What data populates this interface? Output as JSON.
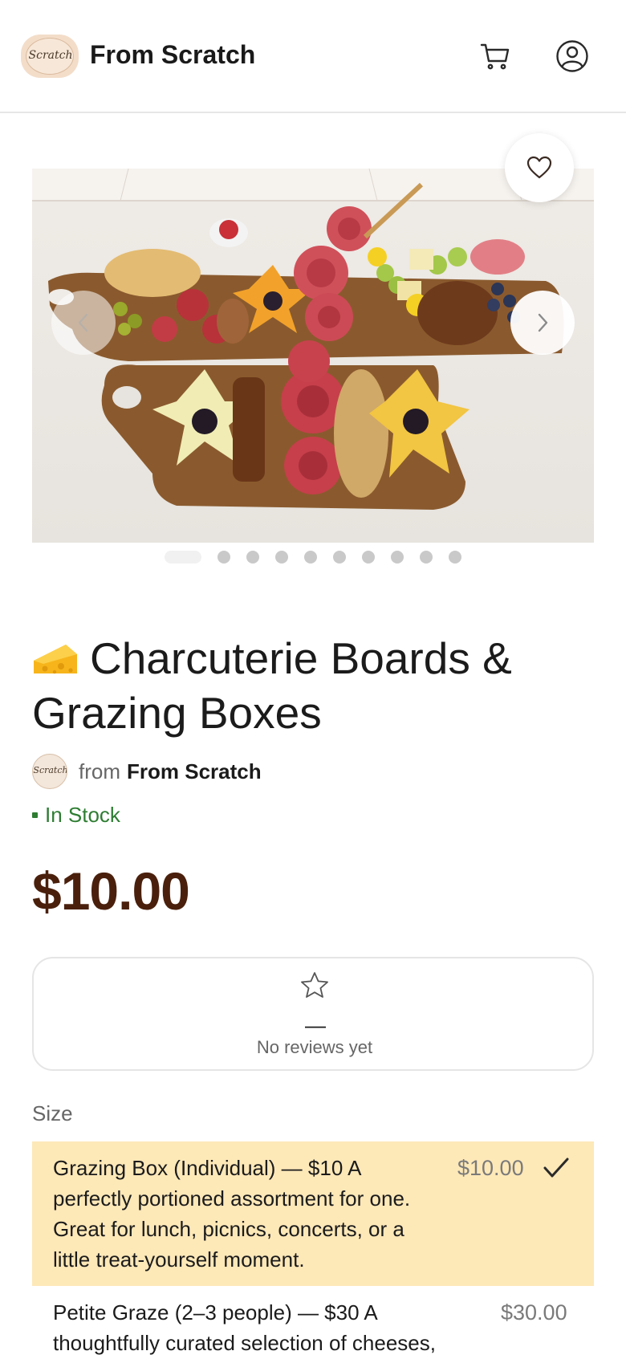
{
  "header": {
    "logo_text": "Scratch",
    "brand": "From Scratch",
    "cart_icon": "cart-icon",
    "account_icon": "user-circle-icon"
  },
  "gallery": {
    "image_alt": "Charcuterie boards with salami roses, cheese flowers, crackers, olives and berries",
    "image_count": 10,
    "active_index": 0,
    "favorite_icon": "heart-icon",
    "prev_icon": "chevron-left-icon",
    "next_icon": "chevron-right-icon"
  },
  "product": {
    "emoji_icon": "cheese-icon",
    "title": "Charcuterie Boards & Grazing Boxes",
    "seller_from": "from",
    "seller_name": "From Scratch",
    "stock": "In Stock",
    "price": "$10.00"
  },
  "reviews": {
    "star_icon": "star-outline-icon",
    "rating_placeholder": "—",
    "empty_text": "No reviews yet"
  },
  "size": {
    "label": "Size",
    "options": [
      {
        "text": "Grazing Box (Individual) — $10 A perfectly portioned assortment for one. Great for lunch, picnics, concerts, or a little treat-yourself moment.",
        "price": "$10.00",
        "selected": true
      },
      {
        "text": "Petite Graze (2–3 people) — $30 A thoughtfully curated selection of cheeses,",
        "price": "$30.00",
        "selected": false
      }
    ]
  },
  "colors": {
    "price": "#4a200c",
    "stock": "#2e7d32",
    "selected_option_bg": "#fde8b8"
  }
}
